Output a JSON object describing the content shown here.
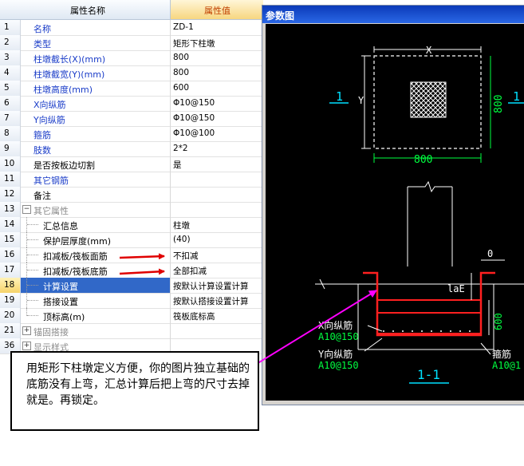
{
  "grid": {
    "header_name": "属性名称",
    "header_value": "属性值",
    "rows": [
      {
        "num": "1",
        "name": "名称",
        "value": "ZD-1"
      },
      {
        "num": "2",
        "name": "类型",
        "value": "矩形下柱墩"
      },
      {
        "num": "3",
        "name": "柱墩截长(X)(mm)",
        "value": "800"
      },
      {
        "num": "4",
        "name": "柱墩截宽(Y)(mm)",
        "value": "800"
      },
      {
        "num": "5",
        "name": "柱墩高度(mm)",
        "value": "600"
      },
      {
        "num": "6",
        "name": "X向纵筋",
        "value": "Φ10@150"
      },
      {
        "num": "7",
        "name": "Y向纵筋",
        "value": "Φ10@150"
      },
      {
        "num": "8",
        "name": "箍筋",
        "value": "Φ10@100"
      },
      {
        "num": "9",
        "name": "肢数",
        "value": "2*2"
      },
      {
        "num": "10",
        "name": "是否按板边切割",
        "value": "是"
      },
      {
        "num": "11",
        "name": "其它钢筋",
        "value": ""
      },
      {
        "num": "12",
        "name": "备注",
        "value": ""
      },
      {
        "num": "13",
        "name": "其它属性",
        "value": "",
        "expander": "−"
      },
      {
        "num": "14",
        "name": "汇总信息",
        "value": "柱墩"
      },
      {
        "num": "15",
        "name": "保护层厚度(mm)",
        "value": "(40)"
      },
      {
        "num": "16",
        "name": "扣减板/筏板面筋",
        "value": "不扣减"
      },
      {
        "num": "17",
        "name": "扣减板/筏板底筋",
        "value": "全部扣减"
      },
      {
        "num": "18",
        "name": "计算设置",
        "value": "按默认计算设置计算"
      },
      {
        "num": "19",
        "name": "搭接设置",
        "value": "按默认搭接设置计算"
      },
      {
        "num": "20",
        "name": "顶标高(m)",
        "value": "筏板底标高"
      },
      {
        "num": "21",
        "name": "锚固搭接",
        "value": "",
        "expander": "+"
      },
      {
        "num": "36",
        "name": "显示样式",
        "value": "",
        "expander": "+"
      }
    ]
  },
  "window": {
    "title": "参数图"
  },
  "drawing": {
    "dim_x": "X",
    "dim_y": "Y",
    "dim_800_bottom": "800",
    "dim_800_right": "800",
    "section_mark_left": "1",
    "section_mark_right": "1",
    "dim_zero": "0",
    "dim_lae": "laE",
    "dim_600": "600",
    "x_bar_label": "X向纵筋",
    "x_bar_spec": "A10@150",
    "y_bar_label": "Y向纵筋",
    "y_bar_spec": "A10@150",
    "stirrup_label": "箍筋",
    "stirrup_spec": "A10@1",
    "section_title": "1-1"
  },
  "callout": {
    "text": "用矩形下柱墩定义方便，你的图片独立基础的底筋没有上弯，汇总计算后把上弯的尺寸去掉就是。再锁定。"
  },
  "colors": {
    "selection": "#3168c8",
    "property_blue": "#1a3cc8",
    "rebar_red": "#ff2020",
    "dim_green": "#00ff40",
    "mark_cyan": "#00e0ff",
    "annotation_arrow": "#ff00ff",
    "pointer_arrow": "#e00000"
  }
}
